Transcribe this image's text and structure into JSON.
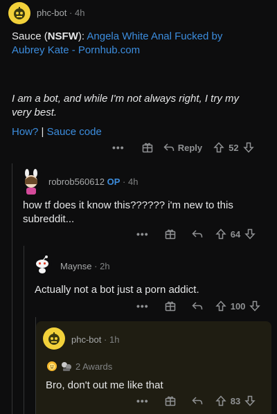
{
  "comments": [
    {
      "username": "phc-bot",
      "age": "4h",
      "sauce_prefix": "Sauce (",
      "sauce_nsfw": "NSFW",
      "sauce_suffix": "): ",
      "sauce_link": "Angela White Anal Fucked by Aubrey Kate - Pornhub.com",
      "disclaimer": "I am a bot, and while I'm not always right, I try my very best.",
      "how_link": "How?",
      "separator": " | ",
      "sauce_code_link": "Sauce code",
      "reply_label": "Reply",
      "score": "52"
    },
    {
      "username": "robrob560612",
      "op_badge": "OP",
      "age": "4h",
      "text": "how tf does it know this?????? i'm new to this subreddit...",
      "score": "64"
    },
    {
      "username": "Maynse",
      "age": "2h",
      "text": "Actually not a bot just a porn addict.",
      "score": "100"
    },
    {
      "username": "phc-bot",
      "age": "1h",
      "awards": "2 Awards",
      "text": "Bro, don't out me like that",
      "score": "83"
    }
  ],
  "meta_separator": "·",
  "more_dots": "•••",
  "colors": {
    "background": "#0d0d0e",
    "highlight_background": "#1f1d12",
    "link": "#3c8dde",
    "text": "#e6e7e8",
    "muted": "#818384",
    "bot_avatar": "#f2d13a"
  }
}
